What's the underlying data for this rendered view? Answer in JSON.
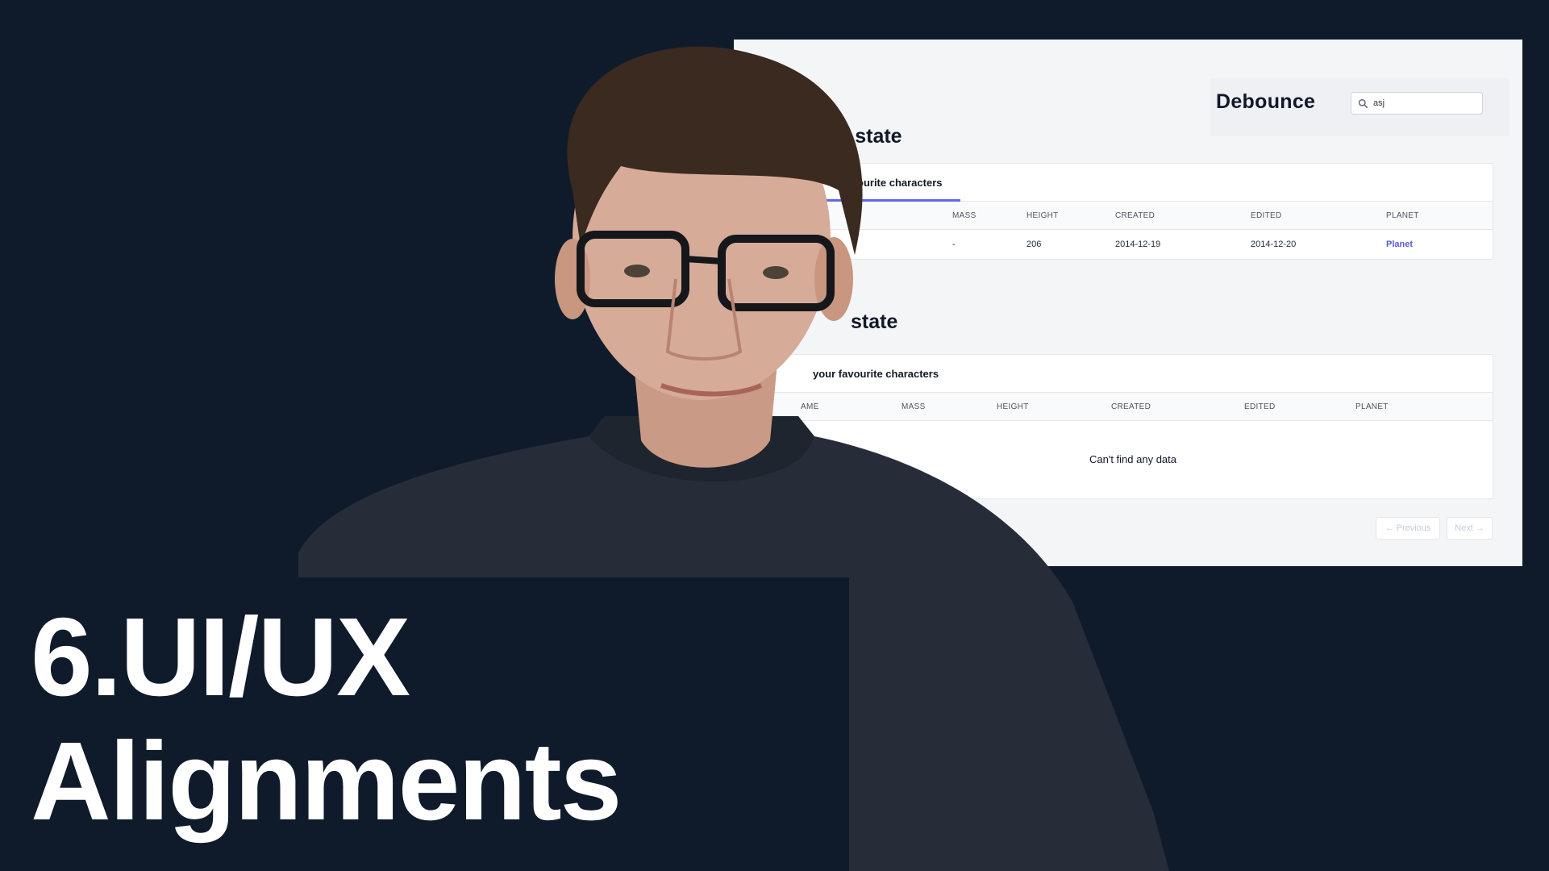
{
  "app": {
    "brand": "Debounce"
  },
  "search": {
    "value": "asj"
  },
  "section1": {
    "title": "g state",
    "tab_label": "ourite characters",
    "columns": [
      "MASS",
      "HEIGHT",
      "CREATED",
      "EDITED",
      "PLANET"
    ],
    "row": [
      "-",
      "206",
      "2014-12-19",
      "2014-12-20",
      "Planet"
    ]
  },
  "section2": {
    "title": "state",
    "tab_label": "your favourite characters",
    "columns": [
      "AME",
      "MASS",
      "HEIGHT",
      "CREATED",
      "EDITED",
      "PLANET"
    ],
    "empty_text": "Can't find any data"
  },
  "pagination": {
    "previous": "← Previous",
    "next": "Next →"
  },
  "overlay": {
    "line1": "6.UI/UX",
    "line2": "Alignments"
  },
  "colors": {
    "background": "#0f1b2b",
    "accent": "#6366f1",
    "link": "#5b5bd6"
  }
}
